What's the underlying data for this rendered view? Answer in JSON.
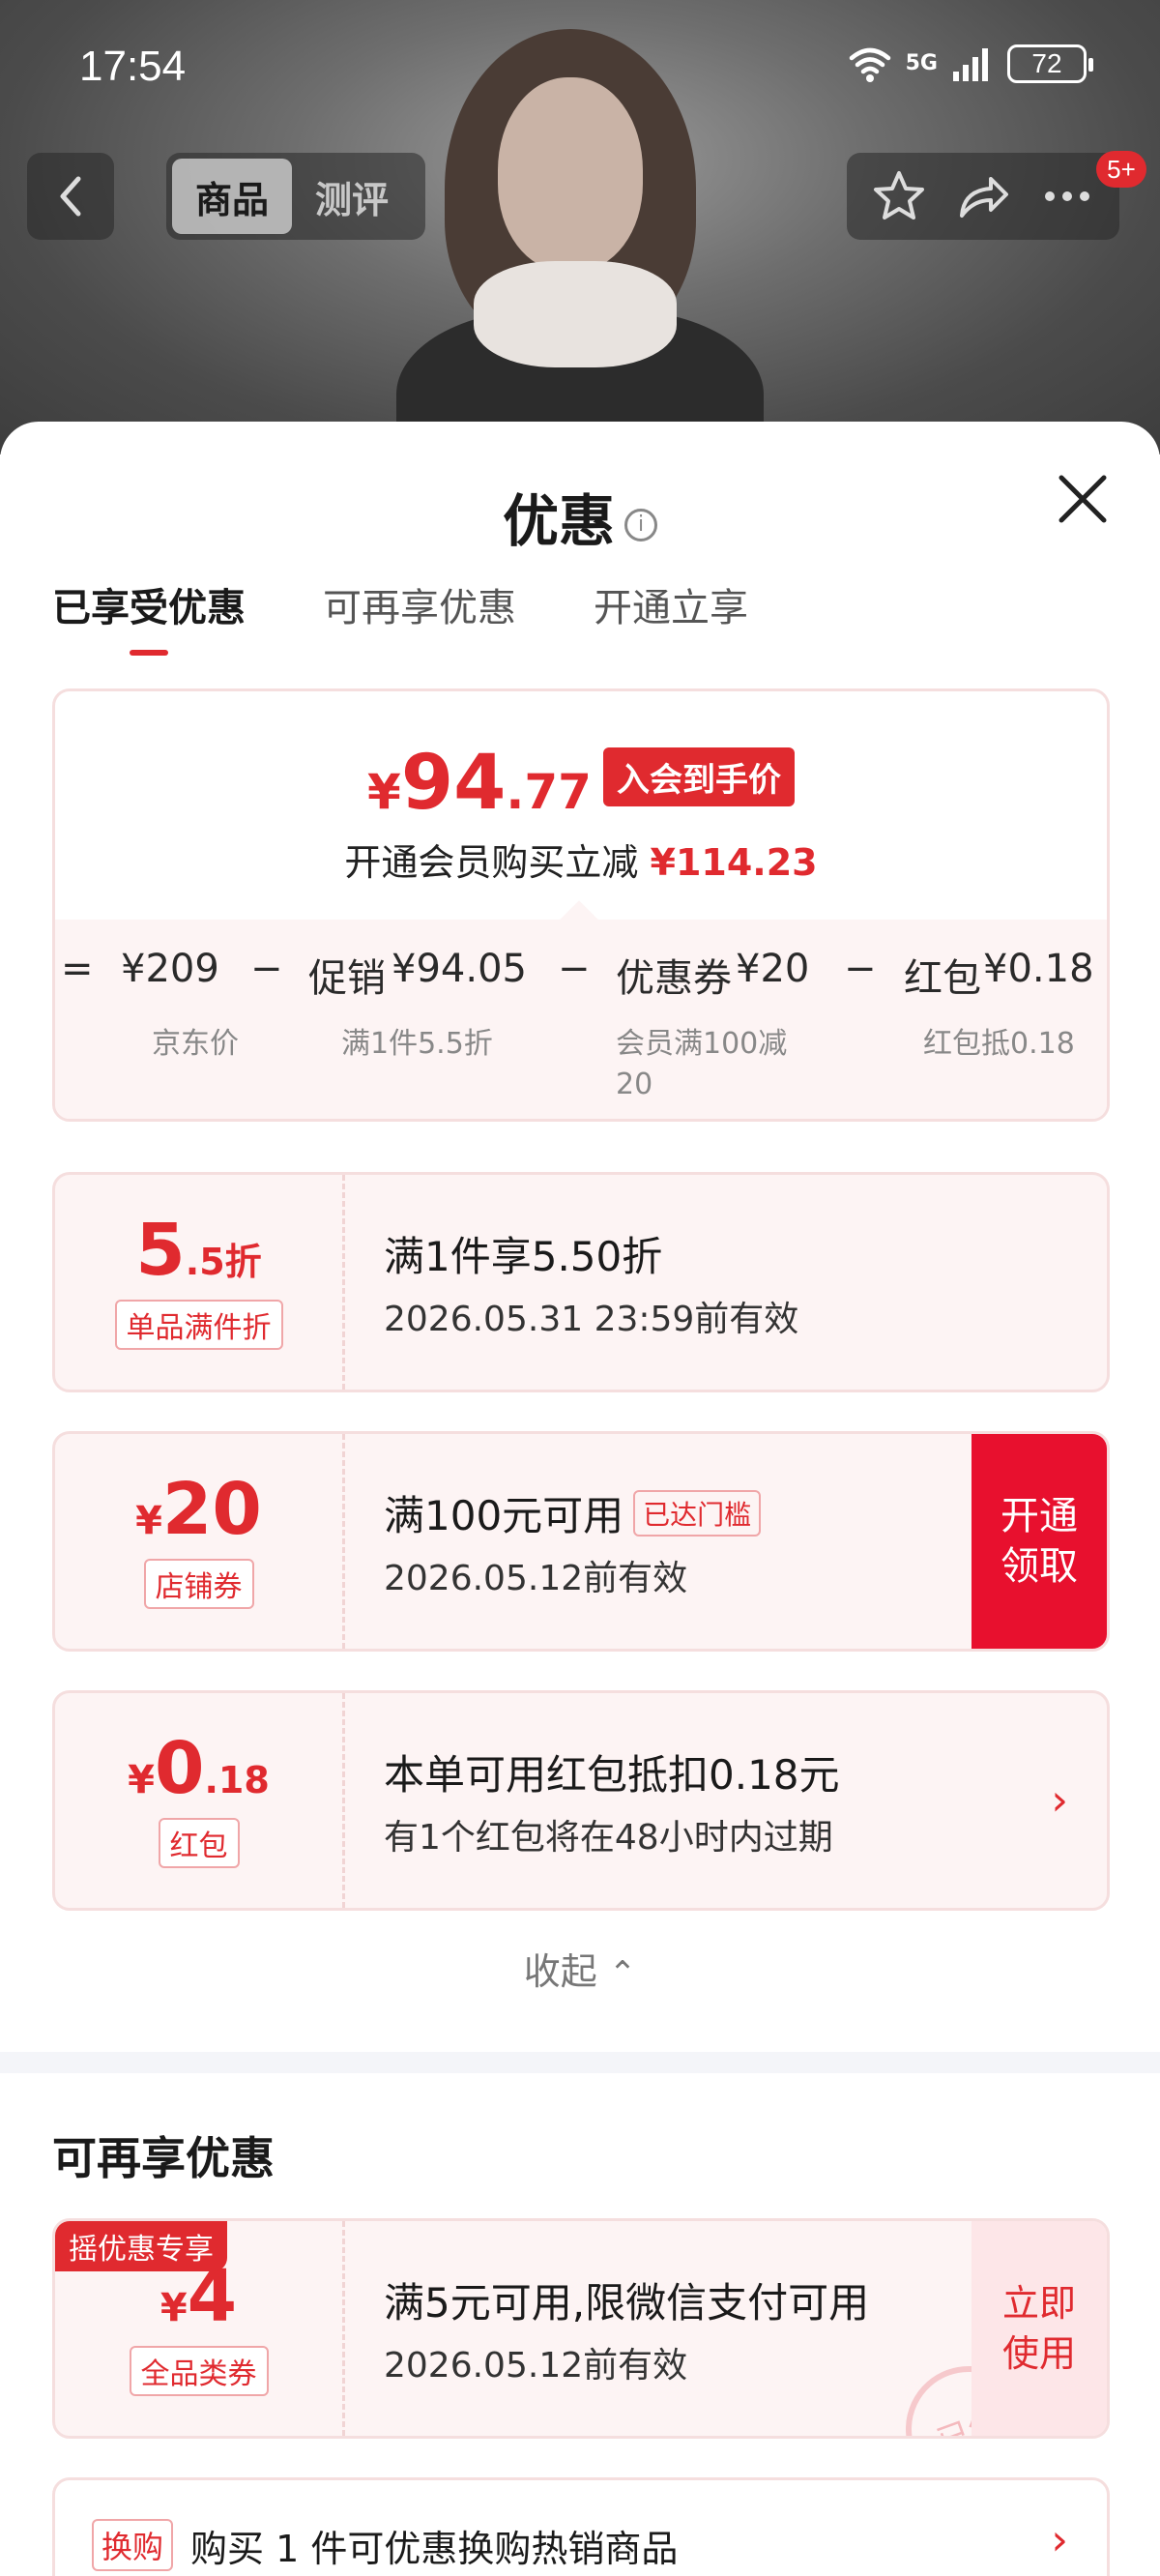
{
  "status": {
    "time": "17:54",
    "network": "5G",
    "battery": "72"
  },
  "nav": {
    "tabs": [
      "商品",
      "测评"
    ],
    "more_badge": "5+"
  },
  "sheet": {
    "title": "优惠",
    "tabs": [
      "已享受优惠",
      "可再享优惠",
      "开通立享"
    ]
  },
  "price_card": {
    "currency": "¥",
    "price_int": "94",
    "price_dec": ".77",
    "tag": "入会到手价",
    "subtitle_prefix": "开通会员购买立减",
    "subtitle_amount": "¥114.23",
    "breakdown": [
      {
        "op": "=",
        "label": "",
        "amount": "¥209",
        "note": "京东价"
      },
      {
        "op": "−",
        "label": "促销",
        "amount": "¥94.05",
        "note": "满1件5.5折"
      },
      {
        "op": "−",
        "label": "优惠券",
        "amount": "¥20",
        "note": "会员满100减20"
      },
      {
        "op": "−",
        "label": "红包",
        "amount": "¥0.18",
        "note": "红包抵0.18"
      }
    ]
  },
  "coupons": [
    {
      "value_big": "5",
      "value_small": ".5折",
      "label": "单品满件折",
      "line1": "满1件享5.50折",
      "line2": "2026.05.31 23:59前有效"
    },
    {
      "value_prefix": "¥",
      "value_big": "20",
      "label": "店铺券",
      "line1": "满100元可用",
      "reach_tag": "已达门槛",
      "line2": "2026.05.12前有效",
      "action": "开通领取"
    },
    {
      "value_prefix": "¥",
      "value_big": "0",
      "value_small": ".18",
      "label": "红包",
      "line1": "本单可用红包抵扣0.18元",
      "line2": "有1个红包将在48小时内过期"
    }
  ],
  "collapse_label": "收起",
  "extra_section": {
    "title": "可再享优惠",
    "coupon": {
      "ribbon": "摇优惠专享",
      "value_prefix": "¥",
      "value_big": "4",
      "label": "全品类券",
      "line1": "满5元可用,限微信支付可用",
      "line2": "2026.05.12前有效",
      "action": "立即使用",
      "stamp": "已领"
    },
    "swap": {
      "tag": "换购",
      "text": "购买 1 件可优惠换购热销商品"
    }
  },
  "colors": {
    "accent": "#e02a2f",
    "claim_button": "#e8102e",
    "card_bg": "#fdf4f4"
  }
}
